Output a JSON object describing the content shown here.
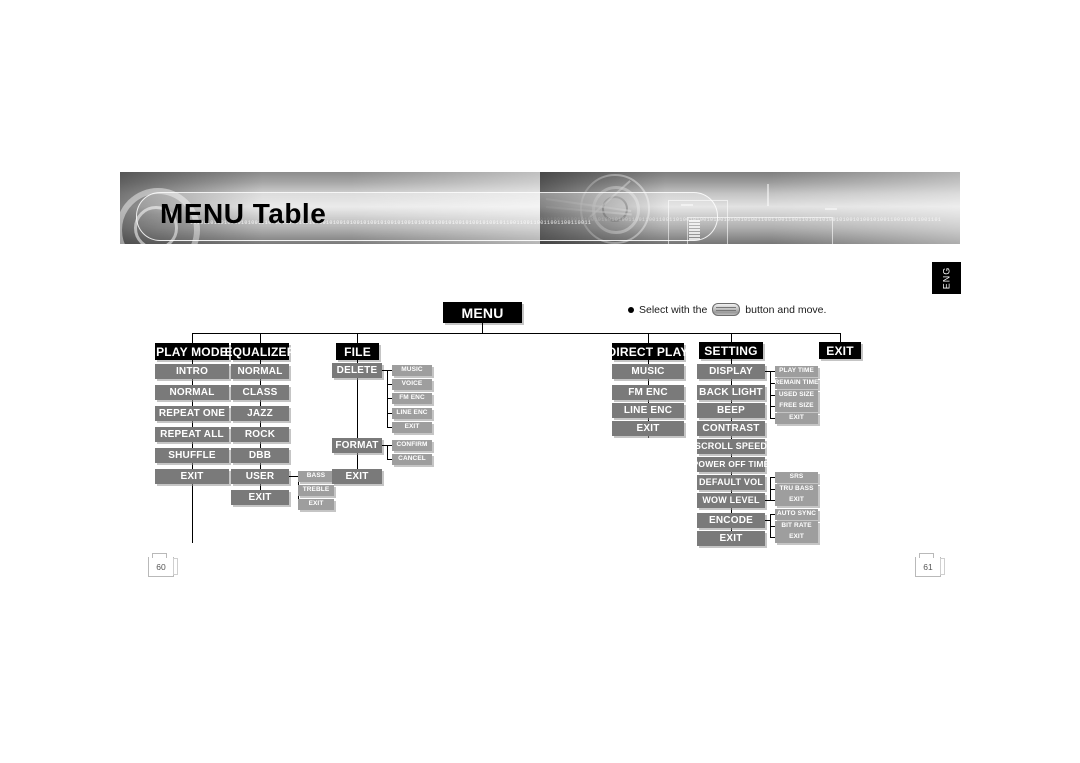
{
  "banner": {
    "title": "MENU Table",
    "binary_text_left": "1010010100101001010010100101001010010100101001010010100101001010010100101001010010100101001011001100110011001100110011",
    "binary_text_right": "0101001010010100101001010011001100110011010010100101001010010100110011001100110100101001010010100101001100110011001101"
  },
  "language_tab": {
    "label": "ENG"
  },
  "note": {
    "text_before": "Select with the",
    "icon": "nav-button-icon",
    "text_after": "button and move."
  },
  "page_numbers": {
    "left": "60",
    "right": "61"
  },
  "tree": {
    "root": {
      "label": "MENU"
    },
    "columns": [
      {
        "id": "play-mode",
        "header": "PLAY MODE",
        "items": [
          "INTRO",
          "NORMAL",
          "REPEAT ONE",
          "REPEAT ALL",
          "SHUFFLE",
          "EXIT"
        ]
      },
      {
        "id": "equalizer",
        "header": "EQUALIZER",
        "items": [
          "NORMAL",
          "CLASS",
          "JAZZ",
          "ROCK",
          "DBB",
          "USER",
          "EXIT"
        ],
        "sub": {
          "parent": "USER",
          "items": [
            "BASS",
            "TREBLE",
            "EXIT"
          ]
        }
      },
      {
        "id": "file",
        "header": "FILE",
        "items": [
          "DELETE",
          "FORMAT",
          "EXIT"
        ],
        "sub_delete": [
          "MUSIC",
          "VOICE",
          "FM ENC",
          "LINE ENC",
          "EXIT"
        ],
        "sub_format": [
          "CONFIRM",
          "CANCEL"
        ]
      },
      {
        "id": "direct-play",
        "header": "DIRECT PLAY",
        "items": [
          "MUSIC",
          "FM ENC",
          "LINE ENC",
          "EXIT"
        ]
      },
      {
        "id": "setting",
        "header": "SETTING",
        "items": [
          "DISPLAY",
          "BACK LIGHT",
          "BEEP",
          "CONTRAST",
          "SCROLL SPEED",
          "POWER OFF TIME",
          "DEFAULT VOL",
          "WOW LEVEL",
          "ENCODE",
          "EXIT"
        ],
        "sub_display": [
          "PLAY TIME",
          "REMAIN TIME",
          "USED SIZE",
          "FREE SIZE",
          "EXIT"
        ],
        "sub_wow": [
          "SRS",
          "TRU BASS",
          "EXIT"
        ],
        "sub_encode": [
          "AUTO SYNC",
          "BIT RATE",
          "EXIT"
        ]
      },
      {
        "id": "exit",
        "header": "EXIT",
        "items": []
      }
    ]
  },
  "colors": {
    "level0_bg": "#000000",
    "level1_bg": "#000000",
    "level2_bg": "#7a7a7a",
    "level3_bg": "#9e9e9e",
    "line": "#000000"
  }
}
